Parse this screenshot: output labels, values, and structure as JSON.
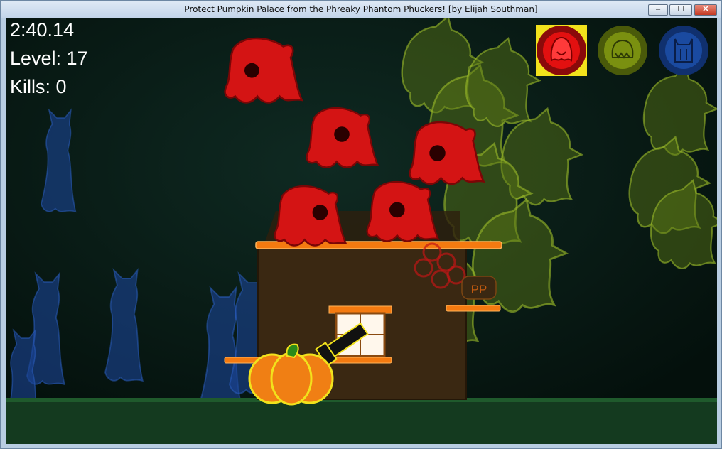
{
  "window": {
    "title": "Protect Pumpkin Palace from the Phreaky Phantom Phuckers! [by Elijah Southman]",
    "controls": {
      "minimize": "–",
      "maximize": "☐",
      "close": "✕"
    }
  },
  "hud": {
    "time": "2:40.14",
    "level": "Level: 17",
    "kills": "Kills: 0"
  },
  "ghost_selector": [
    {
      "name": "red-ghost-type",
      "color": "#e21010",
      "selected": true
    },
    {
      "name": "green-ghost-type",
      "color": "#7a9010",
      "selected": false
    },
    {
      "name": "blue-ghost-type",
      "color": "#1a4aa0",
      "selected": false
    }
  ],
  "house_sign": "PP",
  "colors": {
    "red_ghost": "#d41414",
    "green_ghost": "#7c9a1e",
    "blue_ghost": "#1d4fa8",
    "pumpkin": "#f07f14",
    "platform": "#f47a10",
    "house": "#3a2812",
    "background": "#06140f"
  }
}
